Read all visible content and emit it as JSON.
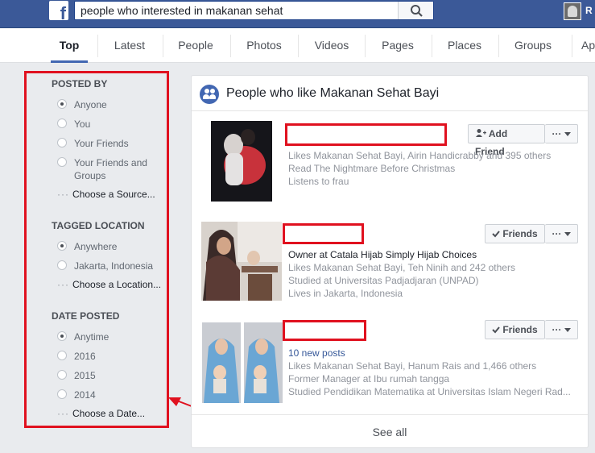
{
  "search": {
    "query": "people who interested in makanan sehat"
  },
  "header": {
    "user_initial": "R"
  },
  "tabs": [
    "Top",
    "Latest",
    "People",
    "Photos",
    "Videos",
    "Pages",
    "Places",
    "Groups",
    "Ap"
  ],
  "filters": {
    "posted_by": {
      "title": "POSTED BY",
      "options": [
        "Anyone",
        "You",
        "Your Friends",
        "Your Friends and Groups"
      ],
      "more": "Choose a Source..."
    },
    "tagged_location": {
      "title": "TAGGED LOCATION",
      "options": [
        "Anywhere",
        "Jakarta, Indonesia"
      ],
      "more": "Choose a Location..."
    },
    "date_posted": {
      "title": "DATE POSTED",
      "options": [
        "Anytime",
        "2016",
        "2015",
        "2014"
      ],
      "more": "Choose a Date..."
    }
  },
  "results": {
    "title": "People who like Makanan Sehat Bayi",
    "people": [
      {
        "button": "Add Friend",
        "lines": [
          "Likes Makanan Sehat Bayi, Airin Handicrabby and 395 others",
          "Read The Nightmare Before Christmas",
          "Listens to frau"
        ]
      },
      {
        "button": "Friends",
        "headline": "Owner at Catala Hijab Simply Hijab Choices",
        "lines": [
          "Likes Makanan Sehat Bayi, Teh Ninih and 242 others",
          "Studied at Universitas Padjadjaran (UNPAD)",
          "Lives in Jakarta, Indonesia"
        ]
      },
      {
        "button": "Friends",
        "headline": "10 new posts",
        "lines": [
          "Likes Makanan Sehat Bayi, Hanum Rais and 1,466 others",
          "Former Manager at Ibu rumah tangga",
          "Studied Pendidikan Matematika at Universitas Islam Negeri Rad..."
        ]
      }
    ],
    "more_label": "···",
    "see_all": "See all"
  }
}
